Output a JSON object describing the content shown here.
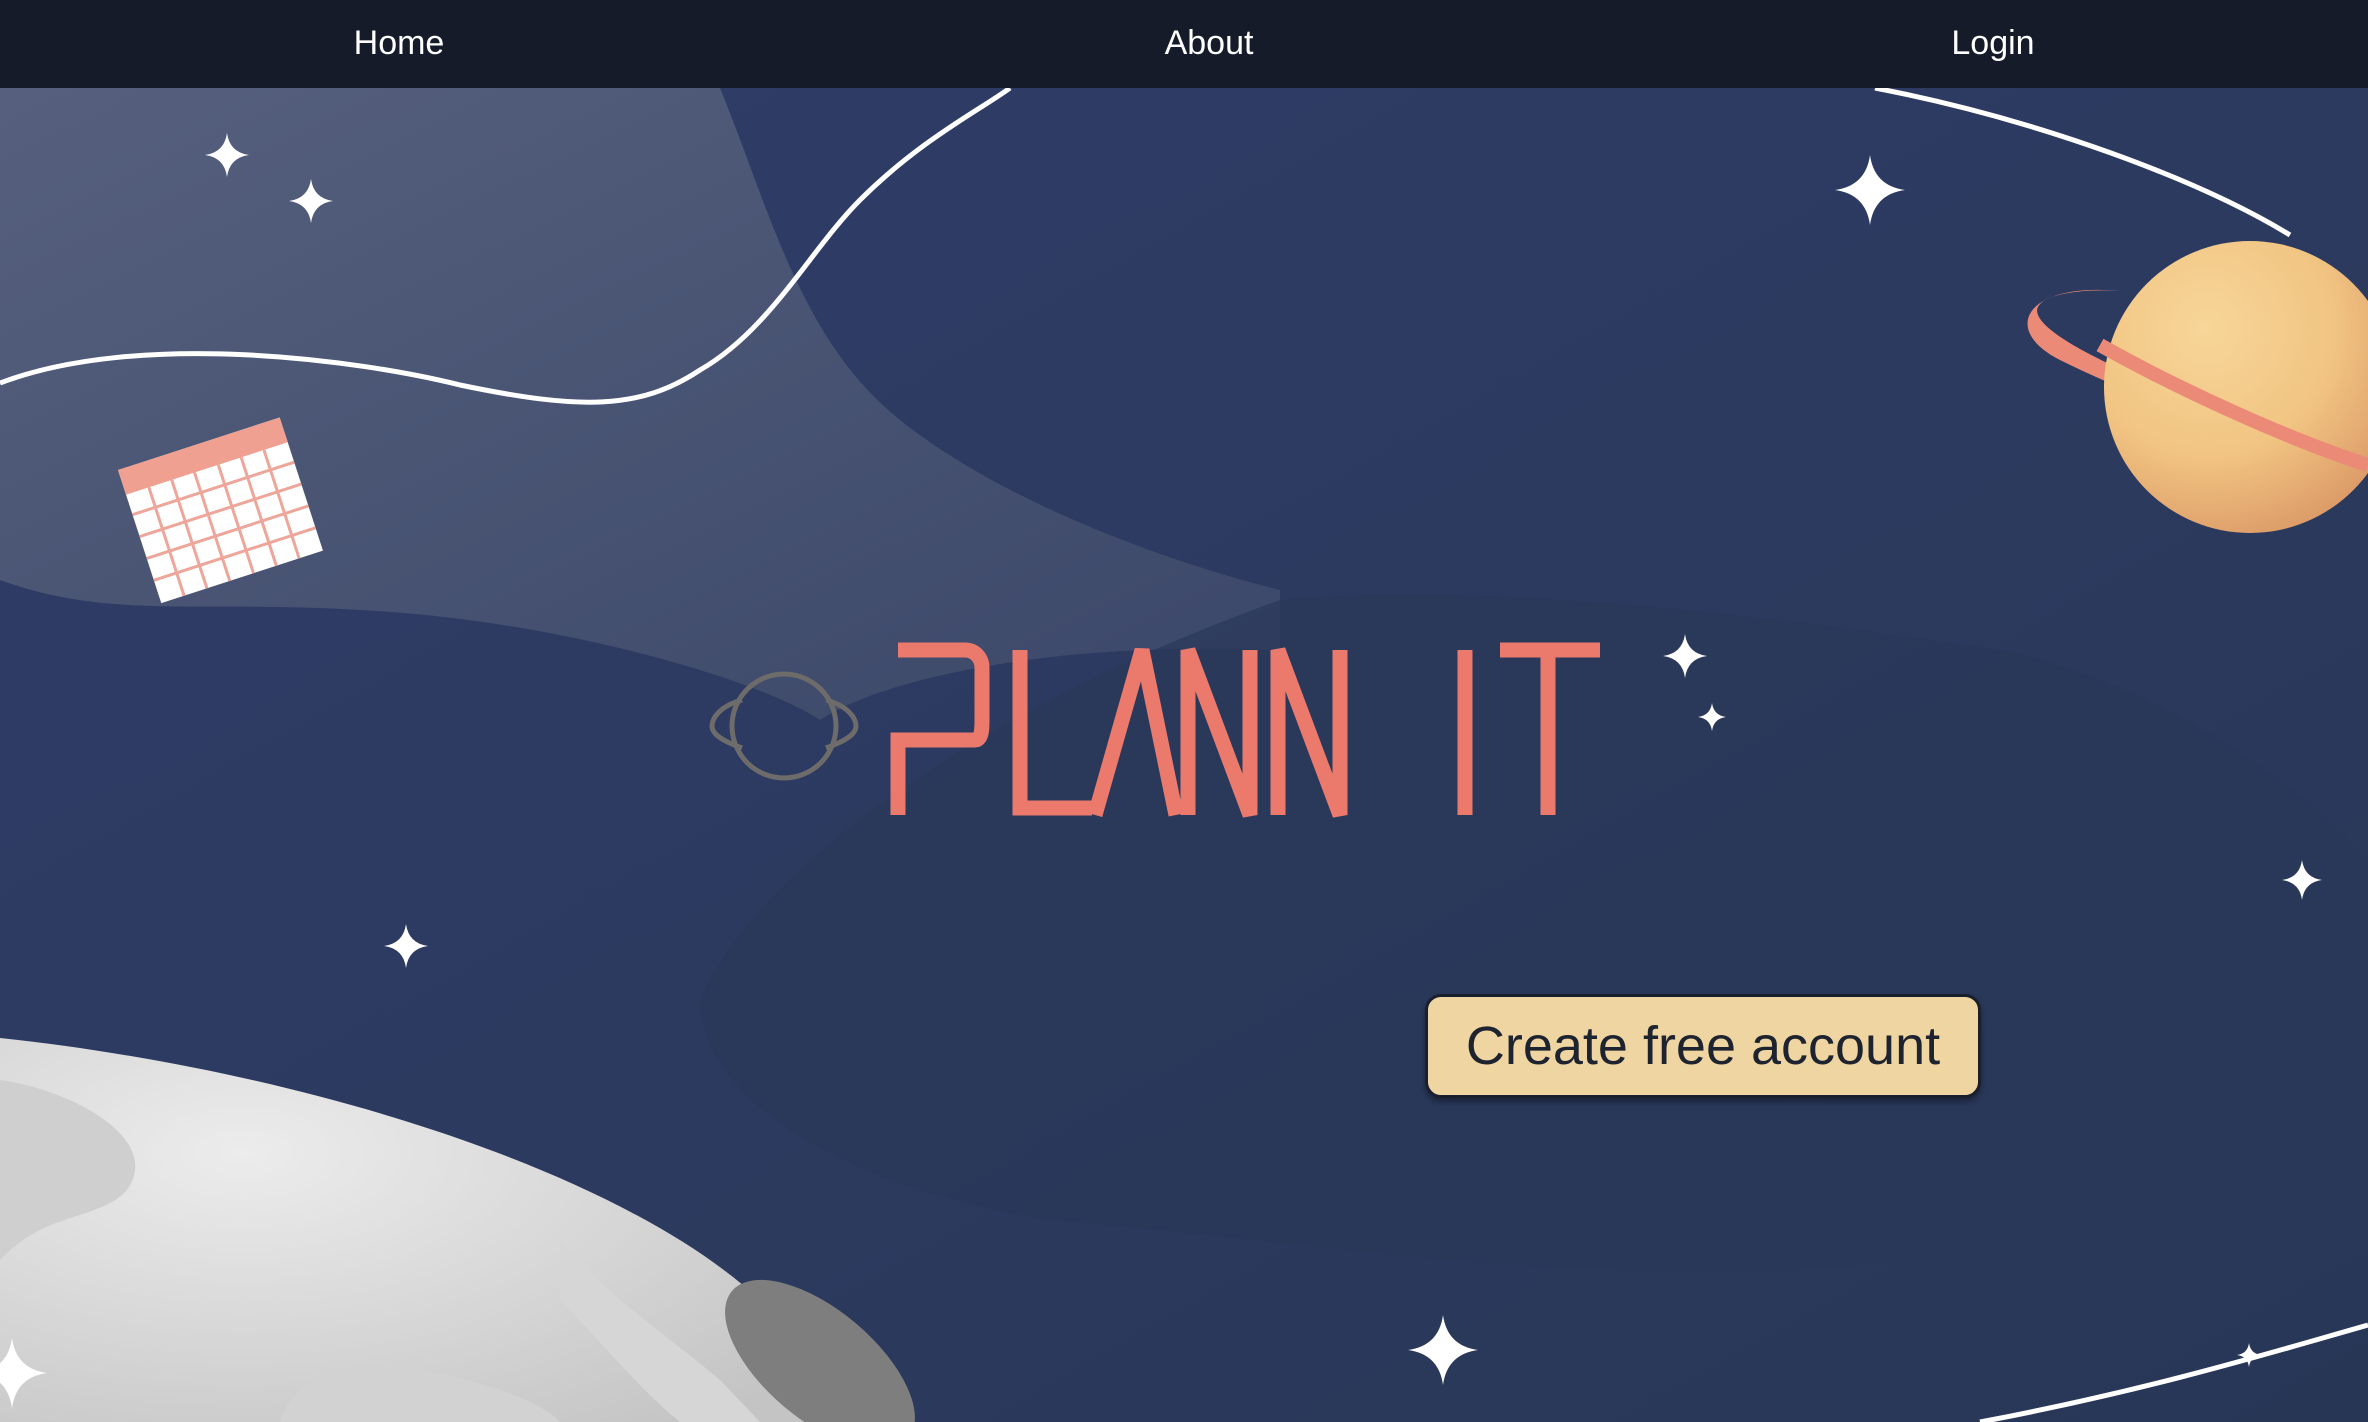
{
  "nav": {
    "home_label": "Home",
    "about_label": "About",
    "login_label": "Login"
  },
  "logo": {
    "wordmark": "PLANNIT",
    "icon": "planet-outline-icon",
    "color": "#ec7a6c"
  },
  "hero": {
    "cta_label": "Create free account",
    "illustrations": [
      "calendar-icon",
      "planet-icon",
      "moon-icon",
      "sparkle-icon"
    ]
  },
  "colors": {
    "navbar_bg": "#151b29",
    "background": "#2b3a5e",
    "accent": "#ec7a6c",
    "button_bg": "#efd5a1",
    "planet": "#f5d08e"
  }
}
